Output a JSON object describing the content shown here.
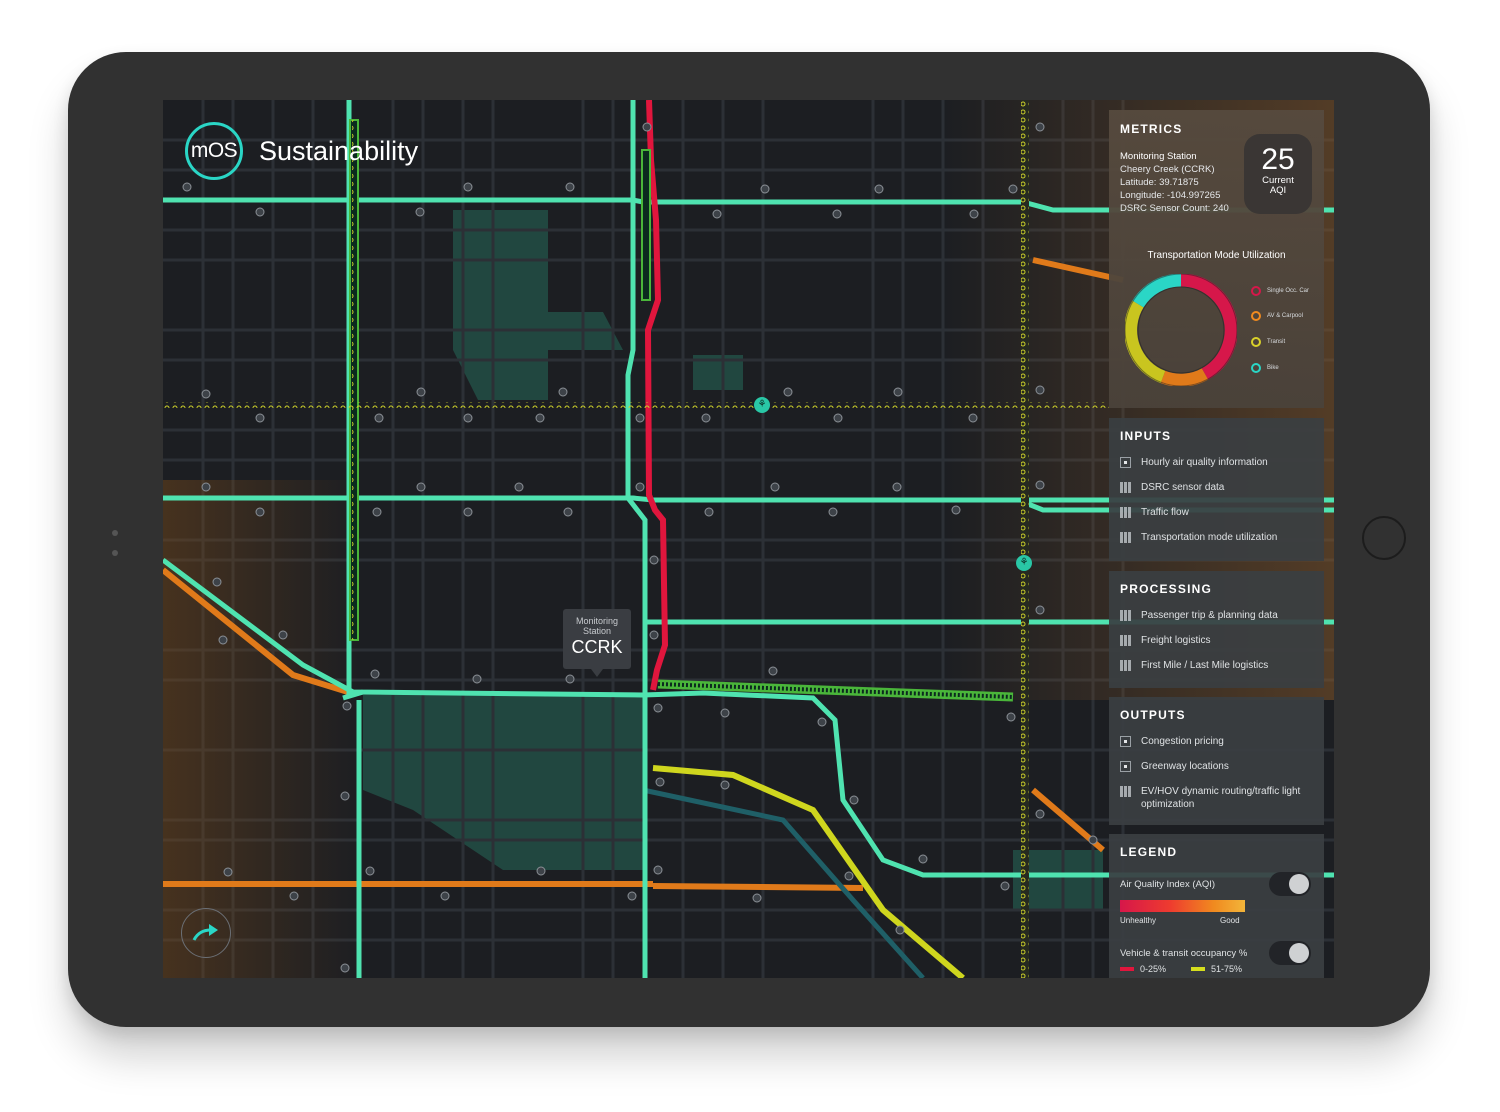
{
  "app": {
    "logo_text": "mOS",
    "title": "Sustainability"
  },
  "map": {
    "callout": {
      "line1": "Monitoring Station",
      "code": "CCRK"
    }
  },
  "metrics": {
    "heading": "METRICS",
    "station": {
      "label": "Monitoring Station",
      "name": "Cheery Creek (CCRK)",
      "latitude": "Latitude: 39.71875",
      "longitude": "Longitude: -104.997265",
      "sensor_count": "DSRC Sensor Count: 240"
    },
    "aqi": {
      "value": "25",
      "label_line1": "Current",
      "label_line2": "AQI"
    },
    "chart_title": "Transportation Mode Utilization",
    "modes": [
      {
        "name": "Single Occ. Car",
        "color": "#d6174a"
      },
      {
        "name": "AV & Carpool",
        "color": "#f08a1f"
      },
      {
        "name": "Transit",
        "color": "#d9d12a"
      },
      {
        "name": "Bike",
        "color": "#2ad6c6"
      }
    ]
  },
  "inputs": {
    "heading": "INPUTS",
    "items": [
      {
        "label": "Hourly air quality information",
        "icon": "box-icon"
      },
      {
        "label": "DSRC sensor data",
        "icon": "grid-icon"
      },
      {
        "label": "Traffic flow",
        "icon": "grid-icon"
      },
      {
        "label": "Transportation mode utilization",
        "icon": "grid-icon"
      }
    ]
  },
  "processing": {
    "heading": "PROCESSING",
    "items": [
      {
        "label": "Passenger trip & planning data",
        "icon": "grid-icon"
      },
      {
        "label": "Freight logistics",
        "icon": "grid-icon"
      },
      {
        "label": "First Mile / Last Mile logistics",
        "icon": "grid-icon"
      }
    ]
  },
  "outputs": {
    "heading": "OUTPUTS",
    "items": [
      {
        "label": "Congestion pricing",
        "icon": "box-icon"
      },
      {
        "label": "Greenway locations",
        "icon": "box-icon"
      },
      {
        "label": "EV/HOV dynamic routing/traffic light optimization",
        "icon": "grid-icon"
      }
    ]
  },
  "legend": {
    "heading": "LEGEND",
    "aqi_label": "Air Quality Index (AQI)",
    "aqi_low": "Unhealthy",
    "aqi_high": "Good",
    "occupancy_label": "Vehicle & transit occupancy %",
    "occupancy_a": "0-25%",
    "occupancy_b": "51-75%"
  },
  "colors": {
    "accent": "#2ad6c6",
    "road": "#4fe3b0",
    "congested": "#e0163d",
    "orange": "#e07a1a",
    "yellow": "#d5de1e"
  }
}
